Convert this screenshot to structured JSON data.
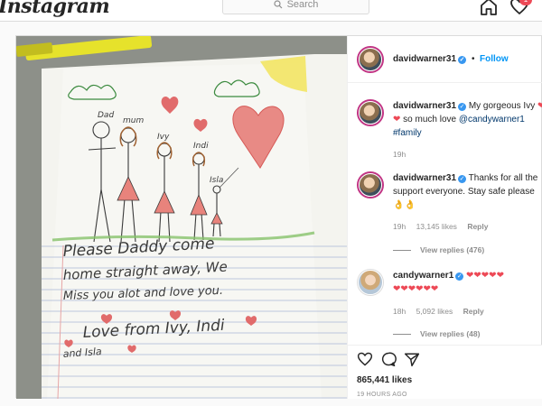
{
  "topbar": {
    "logo": "Instagram",
    "search_placeholder": "Search",
    "notification_count": "1"
  },
  "photo": {
    "labels": {
      "dad": "Dad",
      "mum": "mum",
      "ivy": "Ivy",
      "indi": "Indi",
      "isla": "Isla"
    },
    "letter_lines": [
      "Please Daddy come",
      "home straight away, We",
      "Miss you alot and love you.",
      "Love from Ivy, Indi",
      "and Isla"
    ]
  },
  "post": {
    "author": "davidwarner31",
    "dot": "•",
    "follow_label": "Follow",
    "caption": {
      "username": "davidwarner31",
      "text_1": "My gorgeous Ivy",
      "hearts_1": "❤❤",
      "text_2": "so much love",
      "mention": "@candywarner1",
      "hashtag": "#family",
      "time": "19h"
    },
    "comments": [
      {
        "username": "davidwarner31",
        "text": "Thanks for all the support everyone. Stay safe please 👌👌",
        "time": "19h",
        "likes": "13,145 likes",
        "reply": "Reply",
        "view_replies": "View replies (476)"
      },
      {
        "username": "candywarner1",
        "hearts_line1": "❤❤❤❤❤",
        "hearts_line2": "❤❤❤❤❤❤",
        "time": "18h",
        "likes": "5,092 likes",
        "reply": "Reply",
        "view_replies": "View replies (48)"
      }
    ],
    "likes_count": "865,441 likes",
    "time_ago": "19 HOURS AGO"
  },
  "colors": {
    "link": "#0095f6",
    "heart": "#ed4956",
    "verified": "#3897f0"
  }
}
